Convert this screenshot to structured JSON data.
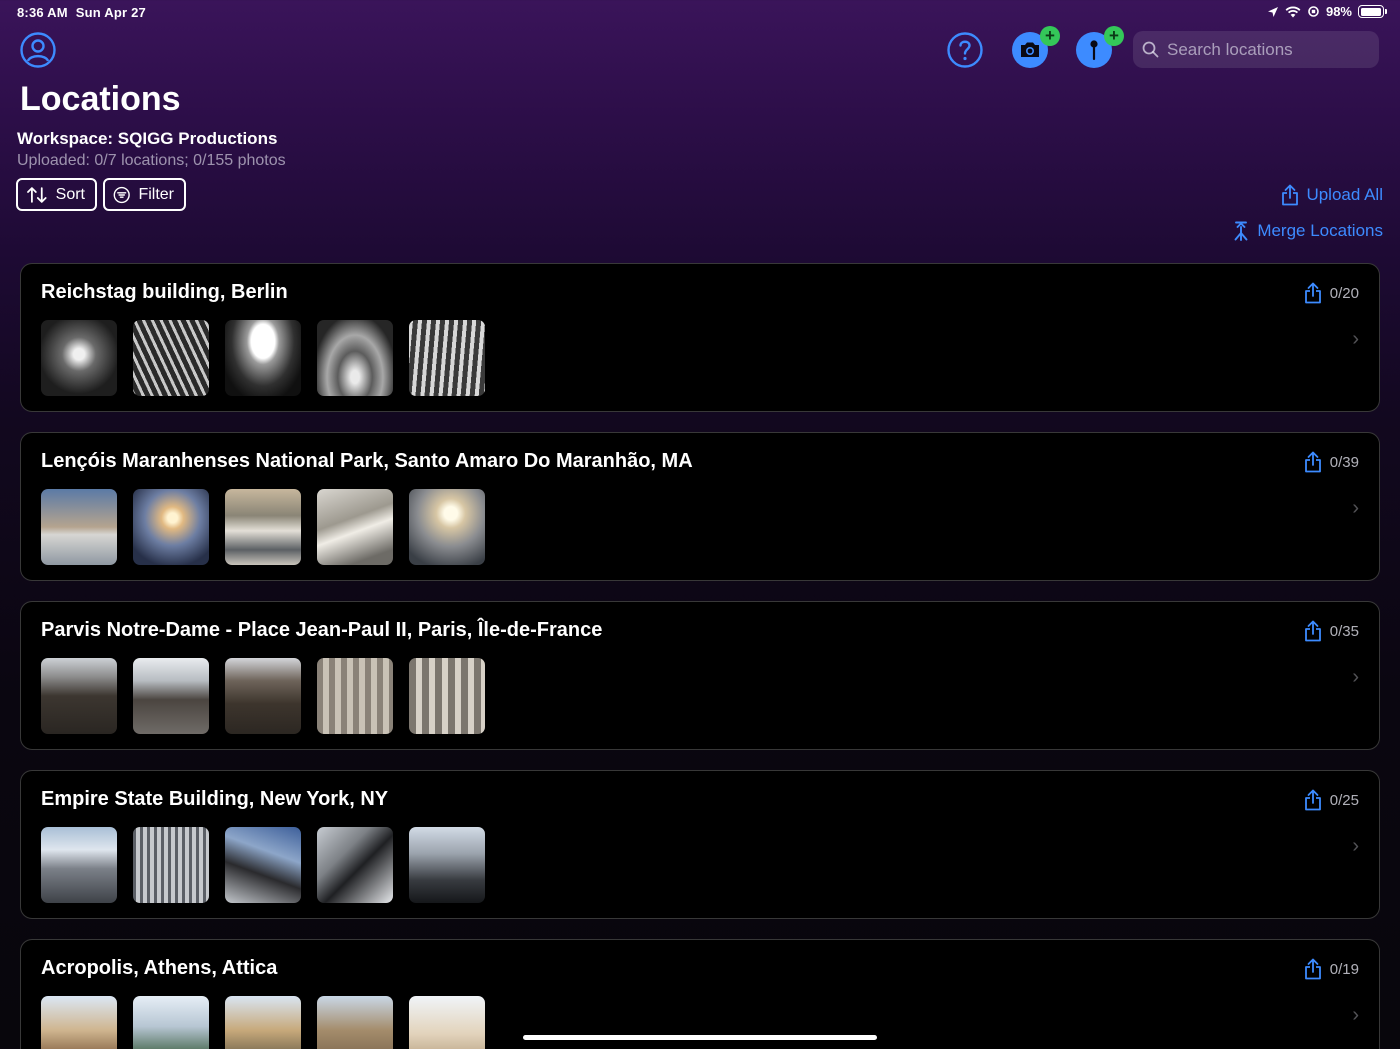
{
  "status_bar": {
    "time": "8:36 AM",
    "date": "Sun Apr 27",
    "battery": "98%",
    "battery_level": 0.98
  },
  "header": {
    "title": "Locations",
    "workspace": "Workspace: SQIGG Productions",
    "uploaded_summary": "Uploaded: 0/7 locations; 0/155 photos",
    "help_icon": "question-circle-icon",
    "camera_icon": "camera-add-icon",
    "pin_icon": "pin-add-icon",
    "badge_symbol": "+"
  },
  "search": {
    "placeholder": "Search locations",
    "value": ""
  },
  "controls": {
    "sort_label": "Sort",
    "filter_label": "Filter",
    "upload_all_label": "Upload All",
    "merge_label": "Merge Locations"
  },
  "colors": {
    "accent": "#3d8bff",
    "badge": "#34c759",
    "background_top": "#3a145a",
    "card_background": "#000000"
  },
  "locations": [
    {
      "name": "Reichstag building, Berlin",
      "status": "0/20"
    },
    {
      "name": "Lençóis Maranhenses National Park, Santo Amaro Do Maranhão, MA",
      "status": "0/39"
    },
    {
      "name": "Parvis Notre-Dame - Place Jean-Paul II, Paris, Île-de-France",
      "status": "0/35"
    },
    {
      "name": "Empire State Building, New York, NY",
      "status": "0/25"
    },
    {
      "name": "Acropolis, Athens, Attica",
      "status": "0/19"
    }
  ]
}
